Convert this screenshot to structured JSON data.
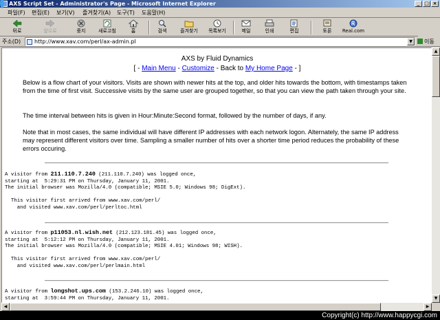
{
  "window": {
    "title": "AXS Script Set - Administrator's Page - Microsoft Internet Explorer",
    "controls": [
      "_",
      "□",
      "×"
    ]
  },
  "menu": [
    "파일(F)",
    "편집(E)",
    "보기(V)",
    "즐겨찾기(A)",
    "도구(T)",
    "도움말(H)"
  ],
  "toolbar": {
    "back": "뒤로",
    "forward": "앞으로",
    "stop": "중지",
    "refresh": "새로고침",
    "home": "홈",
    "search": "검색",
    "favorites": "즐겨찾기",
    "history": "목록보기",
    "mail": "메일",
    "print": "인쇄",
    "edit": "편집",
    "discuss": "토론",
    "realcom": "Real.com"
  },
  "address": {
    "label": "주소(D)",
    "url": "http://www.xav.com/perl/ax-admin.pl",
    "go": "이동"
  },
  "page": {
    "title": "AXS by Fluid Dynamics",
    "nav": {
      "open": "[ - ",
      "main_menu": "Main Menu",
      "dash1": " - ",
      "customize": "Customize",
      "back_to": " - Back to ",
      "home_page": "My Home Page",
      "close": " - ]"
    },
    "para1": "Below is a flow chart of your visitors. Visits are shown with newer hits at the top, and older hits towards the bottom, with timestamps taken from the time of first visit. Successive visits by the same user are grouped together, so that you can view the path taken through your site.",
    "para2": "The time interval between hits is given in Hour:Minute:Second format, followed by the number of days, if any.",
    "para3": "Note that in most cases, the same individual will have different IP addresses with each network logon. Alternately, the same IP address may represent different visitors over time. Sampling a smaller number of hits over a shorter time period reduces the probability of these errors occuring.",
    "visits": [
      {
        "prefix": "A visitor from ",
        "host": "211.110.7.240",
        "rest": " (211.110.7.240) was logged once,",
        "line2": "starting at  5:29:31 PM on Thursday, January 11, 2001.",
        "line3": "The initial browser was Mozilla/4.0 (compatible; MSIE 5.0; Windows 98; DigExt).",
        "line4": "  This visitor first arrived from www.xav.com/perl/",
        "line5": "    and visited www.xav.com/perl/perltoc.html"
      },
      {
        "prefix": "A visitor from ",
        "host": "p11053.nl.wish.net",
        "rest": " (212.123.181.45) was logged once,",
        "line2": "starting at  5:12:12 PM on Thursday, January 11, 2001.",
        "line3": "The initial browser was Mozilla/4.0 (compatible; MSIE 4.01; Windows 98; WISH).",
        "line4": "  This visitor first arrived from www.xav.com/perl/",
        "line5": "    and visited www.xav.com/perl/perlmain.html"
      },
      {
        "prefix": "A visitor from ",
        "host": "longshot.ups.com",
        "rest": " (153.2.246.10) was logged once,",
        "line2": "starting at  3:59:44 PM on Thursday, January 11, 2001."
      }
    ]
  },
  "footer": "Copyright(c) http://www.happycgi.com"
}
